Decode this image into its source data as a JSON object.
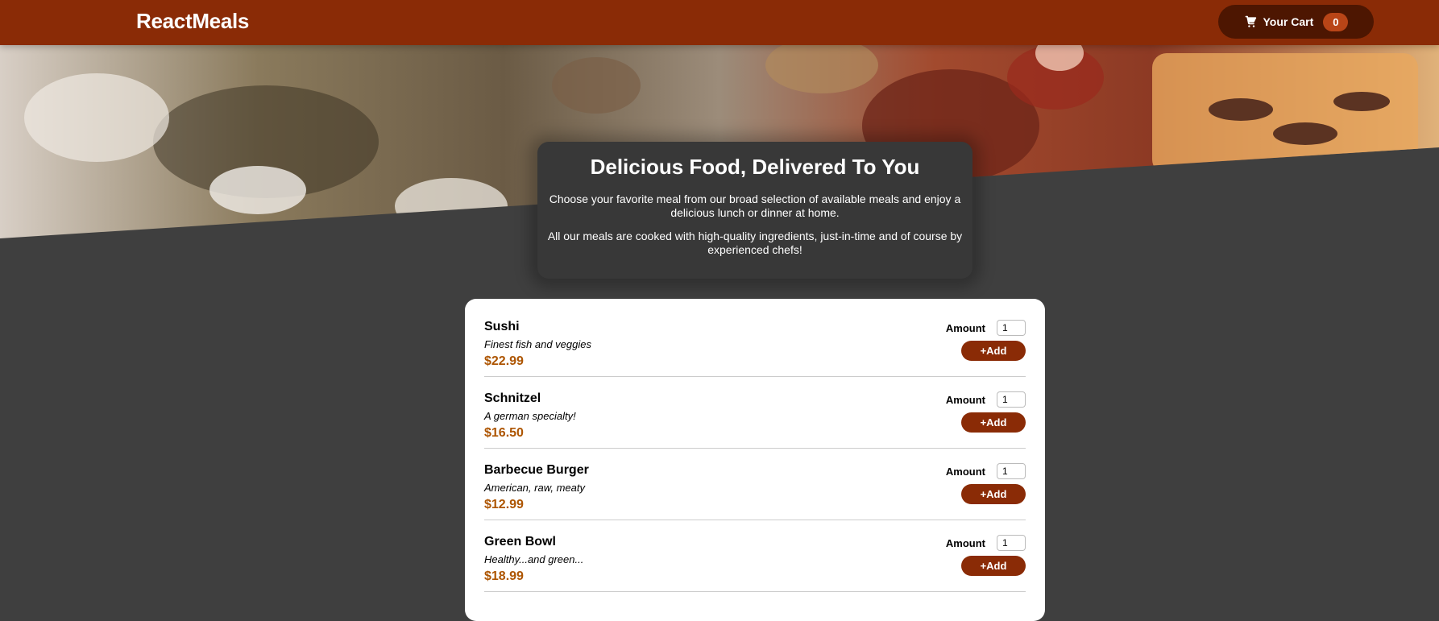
{
  "header": {
    "title": "ReactMeals",
    "cart_label": "Your Cart",
    "cart_count": "0",
    "cart_icon": "shopping-cart-icon"
  },
  "summary": {
    "heading": "Delicious Food, Delivered To You",
    "paragraph1": "Choose your favorite meal from our broad selection of available meals and enjoy a delicious lunch or dinner at home.",
    "paragraph2": "All our meals are cooked with high-quality ingredients, just-in-time and of course by experienced chefs!"
  },
  "meals": {
    "amount_label": "Amount",
    "add_label": "+Add",
    "items": [
      {
        "name": "Sushi",
        "description": "Finest fish and veggies",
        "price": "$22.99",
        "amount": "1"
      },
      {
        "name": "Schnitzel",
        "description": "A german specialty!",
        "price": "$16.50",
        "amount": "1"
      },
      {
        "name": "Barbecue Burger",
        "description": "American, raw, meaty",
        "price": "$12.99",
        "amount": "1"
      },
      {
        "name": "Green Bowl",
        "description": "Healthy...and green...",
        "price": "$18.99",
        "amount": "1"
      }
    ]
  },
  "colors": {
    "header_bg": "#8a2b06",
    "cart_bg": "#4d1601",
    "badge_bg": "#b94517",
    "page_bg": "#3f3f3f",
    "summary_bg": "#383838",
    "price": "#ad5502"
  }
}
